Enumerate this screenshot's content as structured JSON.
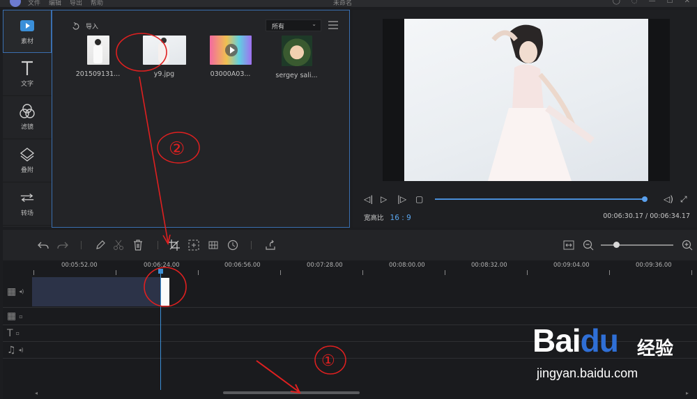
{
  "app": {
    "menu": [
      "文件",
      "编辑",
      "导出",
      "帮助"
    ],
    "title": "未命名"
  },
  "sidebar": {
    "items": [
      {
        "label": "素材",
        "icon": "media-icon",
        "active": true
      },
      {
        "label": "文字",
        "icon": "text-icon",
        "active": false
      },
      {
        "label": "滤镜",
        "icon": "filter-icon",
        "active": false
      },
      {
        "label": "叠附",
        "icon": "overlay-icon",
        "active": false
      },
      {
        "label": "转场",
        "icon": "transition-icon",
        "active": false
      }
    ]
  },
  "media": {
    "import_label": "导入",
    "filter_value": "所有",
    "items": [
      {
        "name": "201509131...",
        "kind": "image-portrait"
      },
      {
        "name": "y9.jpg",
        "kind": "image-dress"
      },
      {
        "name": "03000A03...",
        "kind": "video"
      },
      {
        "name": "sergey sali...",
        "kind": "image-illustration"
      }
    ]
  },
  "preview": {
    "ratio_label": "宽高比",
    "ratio_value": "16 : 9",
    "timecode": "00:06:30.17 / 00:06:34.17",
    "progress": 1.0
  },
  "timeline": {
    "ruler": [
      "00:05:52.00",
      "00:06:24.00",
      "00:06:56.00",
      "00:07:28.00",
      "00:08:00.00",
      "00:08:32.00",
      "00:09:04.00",
      "00:09:36.00"
    ],
    "tracks": [
      "video-track",
      "overlay-track",
      "text-track",
      "music-track"
    ]
  },
  "annotations": {
    "circle_1": "①",
    "circle_2": "②"
  },
  "watermark": {
    "logo_text_a": "Bai",
    "logo_text_b": "du",
    "cn_text": "经验",
    "url": "jingyan.baidu.com"
  },
  "colors": {
    "accent": "#3a8fd9",
    "panel": "#232427",
    "annotation": "#e02020"
  }
}
